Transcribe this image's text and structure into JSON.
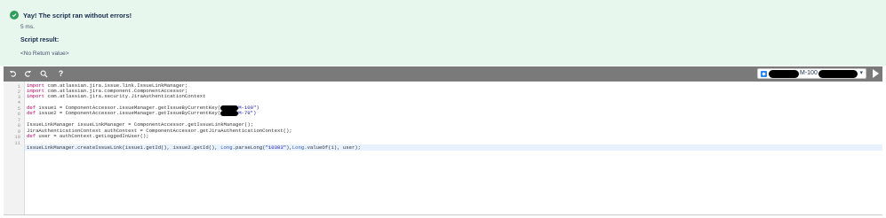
{
  "result": {
    "status": "Yay! The script ran without errors!",
    "time": "5 ms.",
    "result_label": "Script result:",
    "result_value": "<No Return value>",
    "accent": "#2e9e5b"
  },
  "toolbar": {
    "undo_icon": "undo-icon",
    "redo_icon": "redo-icon",
    "search_icon": "search-icon",
    "help_icon": "help-icon",
    "issue_key_suffix": "M-100",
    "run_icon": "run-icon"
  },
  "editor": {
    "line_numbers": [
      "1",
      "2",
      "3",
      "4",
      "5",
      "6",
      "7",
      "8",
      "9",
      "10",
      "11"
    ],
    "lines": [
      {
        "kw": "import",
        "rest": " com.atlassian.jira.issue.link.IssueLinkManager;"
      },
      {
        "kw": "import",
        "rest": " com.atlassian.jira.component.ComponentAccessor;"
      },
      {
        "kw": "import",
        "rest": " com.atlassian.jira.security.JiraAuthenticationContext"
      },
      {
        "kw": "",
        "rest": ""
      },
      {
        "kw": "def",
        "rest": " issue1 = ComponentAccessor.issueManager.getIssueByCurrentKey(",
        "str_end": "M-100\")"
      },
      {
        "kw": "def",
        "rest": " issue2 = ComponentAccessor.issueManager.getIssueByCurrentKey(",
        "str_end": "M-79\")"
      },
      {
        "kw": "",
        "rest": ""
      },
      {
        "kw": "",
        "rest": "IssueLinkManager issueLinkManager = ComponentAccessor.getIssueLinkManager();"
      },
      {
        "kw": "",
        "rest": "JiraAuthenticationContext authContext = ComponentAccessor.getJiraAuthenticationContext();"
      },
      {
        "kw": "def",
        "rest": " user = authContext.getLoggedInUser();"
      },
      {
        "kw": "",
        "rest": "issueLinkManager.createIssueLink(issue1.getId(), issue2.getId(), ",
        "ty1": "Long",
        "mid1": ".parseLong(",
        "str": "\"10303\"",
        "mid2": "),",
        "ty2": "Long",
        "tail": ".valueOf(1), user);"
      }
    ]
  }
}
